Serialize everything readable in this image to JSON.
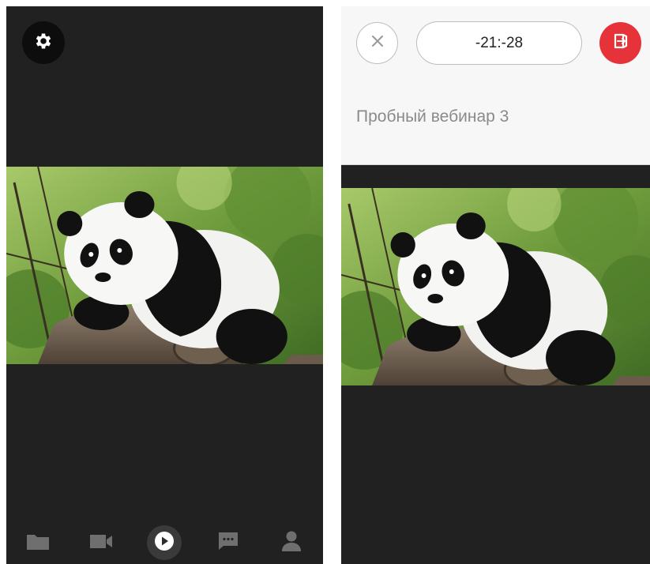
{
  "left": {
    "settings_icon": "gear-icon",
    "video_image": "panda-on-log",
    "nav": [
      {
        "icon": "folder-icon"
      },
      {
        "icon": "video-camera-icon"
      },
      {
        "icon": "play-icon",
        "active": true
      },
      {
        "icon": "chat-icon"
      },
      {
        "icon": "person-icon"
      }
    ]
  },
  "right": {
    "close_icon": "close-icon",
    "timer": "-21:-28",
    "exit_icon": "exit-icon",
    "title": "Пробный вебинар 3",
    "video_image": "panda-on-log"
  },
  "colors": {
    "dark_bg": "#212121",
    "header_bg": "#f7f7f7",
    "exit_red": "#e6333a",
    "nav_icon": "#8a8a8a",
    "title_gray": "#8a8a8a"
  }
}
